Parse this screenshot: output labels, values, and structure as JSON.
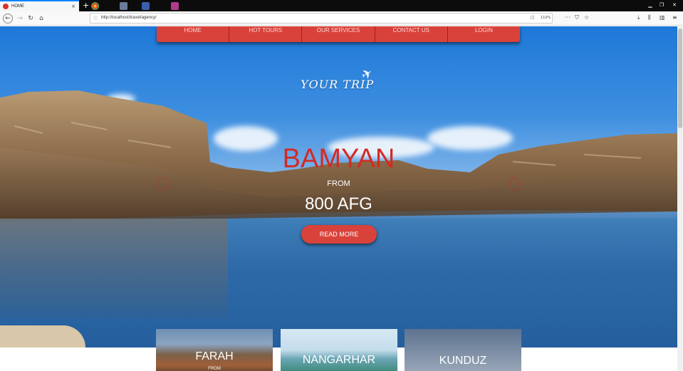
{
  "browser": {
    "tab_title": "HOME",
    "tab_close": "×",
    "new_tab": "+",
    "url": "http://localhost/travel/agency/",
    "zoom": "110%",
    "info_icon": "ⓘ",
    "win_min": "▁",
    "win_restore": "❐",
    "win_close": "✕"
  },
  "menu": {
    "items": [
      "HOME",
      "HOT TOURS",
      "OUR SERVICES",
      "CONTACT US",
      "LOGIN"
    ]
  },
  "logo": {
    "text": "YOUR TRIP",
    "icon": "airplane-icon"
  },
  "hero": {
    "title": "BAMYAN",
    "from": "FROM",
    "price": "800 AFG",
    "button": "READ MORE",
    "prev": "‹",
    "next": "›"
  },
  "cards": [
    {
      "title": "FARAH",
      "from": "FROM"
    },
    {
      "title": "NANGARHAR"
    },
    {
      "title": "KUNDUZ"
    }
  ],
  "colors": {
    "accent": "#d9423a",
    "title_red": "#d42a24"
  }
}
